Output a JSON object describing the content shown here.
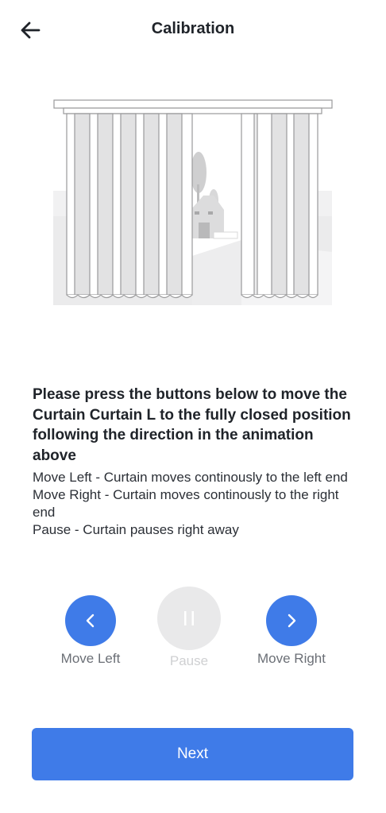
{
  "header": {
    "title": "Calibration",
    "back_icon": "arrow-left-icon"
  },
  "instructions": {
    "heading": "Please press the buttons below to move the Curtain Curtain L to the fully closed position following the direction in the animation above",
    "lines": [
      "Move Left - Curtain moves continously to the left end",
      "Move Right - Curtain moves continously to the right end",
      "Pause - Curtain pauses right away"
    ]
  },
  "controls": {
    "move_left": {
      "label": "Move Left",
      "icon": "chevron-left-icon"
    },
    "pause": {
      "label": "Pause",
      "icon": "pause-icon",
      "enabled": false
    },
    "move_right": {
      "label": "Move Right",
      "icon": "chevron-right-icon"
    }
  },
  "footer": {
    "next_label": "Next"
  },
  "colors": {
    "accent": "#3f7be8",
    "disabled": "#e9e9ea",
    "disabled_text": "#cfd0d2",
    "text": "#1f2329"
  }
}
